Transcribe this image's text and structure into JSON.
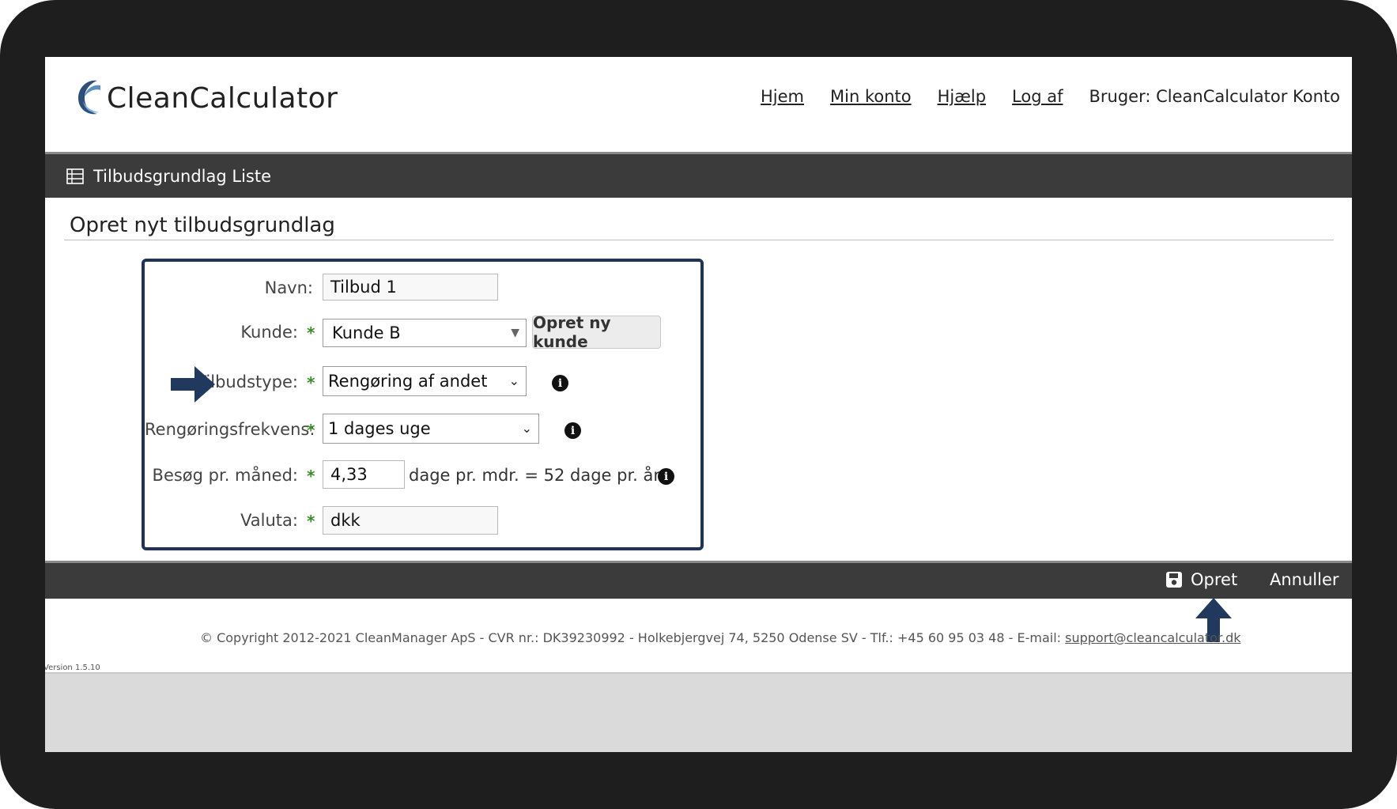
{
  "app": {
    "name": "CleanCalculator"
  },
  "nav": {
    "items": [
      "Hjem",
      "Min konto",
      "Hjælp",
      "Log af"
    ],
    "user": "Bruger: CleanCalculator Konto"
  },
  "titlebar": {
    "title": "Tilbudsgrundlag Liste",
    "icon": "table-icon"
  },
  "page": {
    "heading": "Opret nyt tilbudsgrundlag"
  },
  "form": {
    "name_label": "Navn:",
    "name_value": "Tilbud 1",
    "customer_label": "Kunde:",
    "customer_value": "Kunde B",
    "new_customer_button": "Opret ny kunde",
    "offer_type_label": "Tilbudstype:",
    "offer_type_value": "Rengøring af andet",
    "frequency_label": "Rengøringsfrekvens:",
    "frequency_value": "1 dages uge",
    "visits_label": "Besøg pr. måned:",
    "visits_value": "4,33",
    "visits_suffix": "dage pr. mdr. = 52 dage pr. år",
    "currency_label": "Valuta:",
    "currency_value": "dkk",
    "required_mark": "*",
    "info_glyph": "i"
  },
  "actions": {
    "create": "Opret",
    "cancel": "Annuller",
    "create_icon": "save-icon"
  },
  "footer": {
    "copyright": "© Copyright 2012-2021 CleanManager ApS - CVR nr.: DK39230992 - Holkebjergvej 74, 5250 Odense SV - Tlf.: +45 60 95 03 48 - E-mail: ",
    "email": "support@cleancalculator.dk",
    "version": "Version 1.5.10"
  },
  "colors": {
    "frame": "#1e1e1e",
    "bar": "#3b3b3b",
    "accent": "#1f3352",
    "required": "#3a8a2a"
  }
}
